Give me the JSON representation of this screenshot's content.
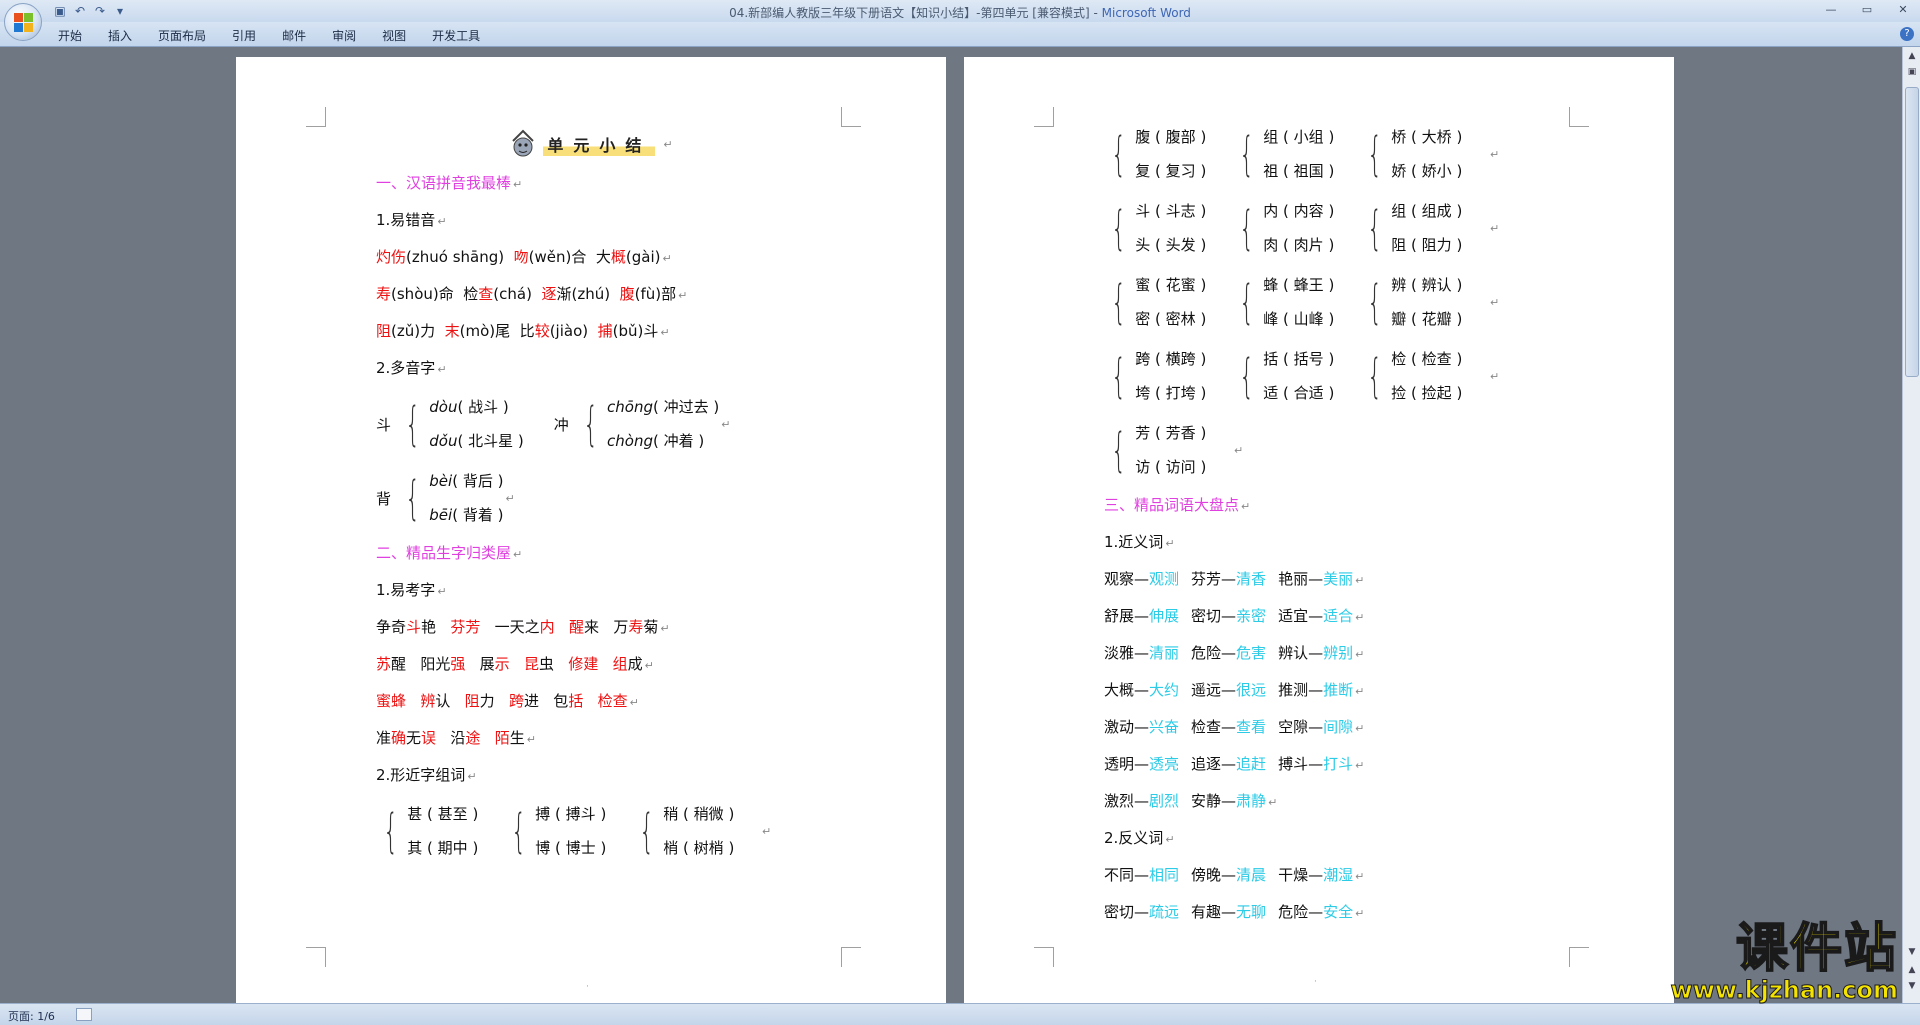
{
  "window": {
    "title": "04.新部编人教版三年级下册语文【知识小结】-第四单元 [兼容模式] - ",
    "app": "Microsoft Word"
  },
  "ribbon": {
    "tabs": [
      "开始",
      "插入",
      "页面布局",
      "引用",
      "邮件",
      "审阅",
      "视图",
      "开发工具"
    ]
  },
  "status": {
    "page": "页面: 1/6"
  },
  "watermark": {
    "brand": "课件站",
    "url": "www.kjzhan.com"
  },
  "colors": {
    "pink": "#e040e0",
    "red": "#ee1111",
    "cyan": "#2ccbe6"
  },
  "left_page": {
    "title": "单元小结",
    "sec1": "一、汉语拼音我最棒",
    "sub1": "1.易错音",
    "mis_lines": [
      [
        {
          "t": "灼伤",
          "c": "red"
        },
        {
          "t": "(zhuó shāng)  "
        },
        {
          "t": "吻",
          "c": "red"
        },
        {
          "t": "(wěn)合  大"
        },
        {
          "t": "概",
          "c": "red"
        },
        {
          "t": "(gài)"
        }
      ],
      [
        {
          "t": "寿",
          "c": "red"
        },
        {
          "t": "(shòu)命  检"
        },
        {
          "t": "查",
          "c": "red"
        },
        {
          "t": "(chá)  "
        },
        {
          "t": "逐",
          "c": "red"
        },
        {
          "t": "渐(zhú)  "
        },
        {
          "t": "腹",
          "c": "red"
        },
        {
          "t": "(fù)部"
        }
      ],
      [
        {
          "t": "阻",
          "c": "red"
        },
        {
          "t": "(zǔ)力  "
        },
        {
          "t": "末",
          "c": "red"
        },
        {
          "t": "(mò)尾  比"
        },
        {
          "t": "较",
          "c": "red"
        },
        {
          "t": "(jiào)  "
        },
        {
          "t": "捕",
          "c": "red"
        },
        {
          "t": "(bǔ)斗"
        }
      ]
    ],
    "sub2": "2.多音字",
    "poly": [
      {
        "char": "斗",
        "rows": [
          [
            "dòu",
            "( 战斗 )"
          ],
          [
            "dǒu",
            "( 北斗星 )"
          ]
        ]
      },
      {
        "char": "冲",
        "rows": [
          [
            "chōng",
            "( 冲过去 )"
          ],
          [
            "chòng",
            "( 冲着 )"
          ]
        ]
      },
      {
        "char": "背",
        "rows": [
          [
            "bèi",
            "( 背后 )"
          ],
          [
            "bēi",
            "( 背着 )"
          ]
        ]
      }
    ],
    "sec2": "二、精品生字归类屋",
    "sub3": "1.易考字",
    "easy_lines": [
      [
        {
          "t": "争奇"
        },
        {
          "t": "斗",
          "c": "red"
        },
        {
          "t": "艳   "
        },
        {
          "t": "芬芳",
          "c": "red"
        },
        {
          "t": "   一天之"
        },
        {
          "t": "内",
          "c": "red"
        },
        {
          "t": "   "
        },
        {
          "t": "醒",
          "c": "red"
        },
        {
          "t": "来   万"
        },
        {
          "t": "寿",
          "c": "red"
        },
        {
          "t": "菊"
        }
      ],
      [
        {
          "t": "苏",
          "c": "red"
        },
        {
          "t": "醒   阳光"
        },
        {
          "t": "强",
          "c": "red"
        },
        {
          "t": "   展"
        },
        {
          "t": "示",
          "c": "red"
        },
        {
          "t": "   "
        },
        {
          "t": "昆",
          "c": "red"
        },
        {
          "t": "虫   "
        },
        {
          "t": "修建",
          "c": "red"
        },
        {
          "t": "   "
        },
        {
          "t": "组",
          "c": "red"
        },
        {
          "t": "成"
        }
      ],
      [
        {
          "t": "蜜蜂",
          "c": "red"
        },
        {
          "t": "   "
        },
        {
          "t": "辨",
          "c": "red"
        },
        {
          "t": "认   "
        },
        {
          "t": "阻",
          "c": "red"
        },
        {
          "t": "力   "
        },
        {
          "t": "跨",
          "c": "red"
        },
        {
          "t": "进   包"
        },
        {
          "t": "括",
          "c": "red"
        },
        {
          "t": "   "
        },
        {
          "t": "检查",
          "c": "red"
        }
      ],
      [
        {
          "t": "准"
        },
        {
          "t": "确",
          "c": "red"
        },
        {
          "t": "无"
        },
        {
          "t": "误",
          "c": "red"
        },
        {
          "t": "   沿"
        },
        {
          "t": "途",
          "c": "red"
        },
        {
          "t": "   "
        },
        {
          "t": "陌",
          "c": "red"
        },
        {
          "t": "生"
        }
      ]
    ],
    "sub4": "2.形近字组词",
    "similar_row": [
      [
        "甚 ( 甚至 )",
        "其 ( 期中 )"
      ],
      [
        "搏 ( 搏斗 )",
        "博 ( 博士 )"
      ],
      [
        "稍 ( 稍微 )",
        "梢 ( 树梢 )"
      ]
    ]
  },
  "right_page": {
    "similar_rows": [
      [
        [
          "腹 ( 腹部 )",
          "复 ( 复习 )"
        ],
        [
          "组 ( 小组 )",
          "祖 ( 祖国 )"
        ],
        [
          "桥 ( 大桥 )",
          "娇 ( 娇小 )"
        ]
      ],
      [
        [
          "斗 ( 斗志 )",
          "头 ( 头发 )"
        ],
        [
          "内 ( 内容 )",
          "肉 ( 肉片 )"
        ],
        [
          "组 ( 组成 )",
          "阻 ( 阻力 )"
        ]
      ],
      [
        [
          "蜜 ( 花蜜 )",
          "密 ( 密林 )"
        ],
        [
          "蜂 ( 蜂王 )",
          "峰 ( 山峰 )"
        ],
        [
          "辨 ( 辨认 )",
          "瓣 ( 花瓣 )"
        ]
      ],
      [
        [
          "跨 ( 横跨 )",
          "垮 ( 打垮 )"
        ],
        [
          "括 ( 括号 )",
          "适 ( 合适 )"
        ],
        [
          "检 ( 检查 )",
          "捡 ( 捡起 )"
        ]
      ],
      [
        [
          "芳 ( 芳香 )",
          "访 ( 访问 )"
        ]
      ]
    ],
    "sec3": "三、精品词语大盘点",
    "sub1": "1.近义词",
    "syn_lines": [
      [
        [
          "观察—",
          "观测"
        ],
        [
          "芬芳—",
          "清香"
        ],
        [
          "艳丽—",
          "美丽"
        ]
      ],
      [
        [
          "舒展—",
          "伸展"
        ],
        [
          "密切—",
          "亲密"
        ],
        [
          "适宜—",
          "适合"
        ]
      ],
      [
        [
          "淡雅—",
          "清丽"
        ],
        [
          "危险—",
          "危害"
        ],
        [
          "辨认—",
          "辨别"
        ]
      ],
      [
        [
          "大概—",
          "大约"
        ],
        [
          "遥远—",
          "很远"
        ],
        [
          "推测—",
          "推断"
        ]
      ],
      [
        [
          "激动—",
          "兴奋"
        ],
        [
          "检查—",
          "查看"
        ],
        [
          "空隙—",
          "间隙"
        ]
      ],
      [
        [
          "透明—",
          "透亮"
        ],
        [
          "追逐—",
          "追赶"
        ],
        [
          "搏斗—",
          "打斗"
        ]
      ],
      [
        [
          "激烈—",
          "剧烈"
        ],
        [
          "安静—",
          "肃静"
        ]
      ]
    ],
    "sub2": "2.反义词",
    "ant_lines": [
      [
        [
          "不同—",
          "相同"
        ],
        [
          "傍晚—",
          "清晨"
        ],
        [
          "干燥—",
          "潮湿"
        ]
      ],
      [
        [
          "密切—",
          "疏远"
        ],
        [
          "有趣—",
          "无聊"
        ],
        [
          "危险—",
          "安全"
        ]
      ]
    ]
  }
}
